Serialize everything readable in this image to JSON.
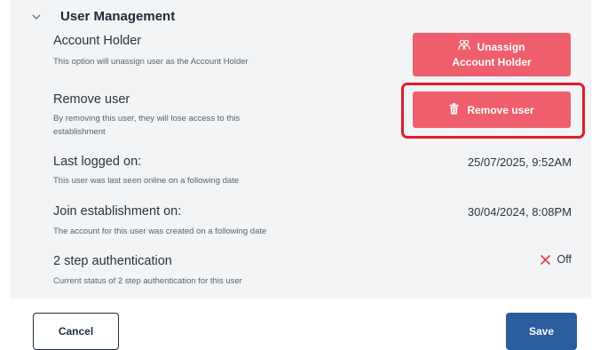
{
  "section": {
    "title": "User Management",
    "chevron_icon": "chevron-down-icon"
  },
  "account_holder": {
    "title": "Account Holder",
    "description": "This option will unassign user as the Account Holder",
    "button_line1": "Unassign",
    "button_line2": "Account Holder",
    "button_icon": "users-icon"
  },
  "remove_user": {
    "title": "Remove user",
    "description_line1": "By removing this user, they will lose access to this",
    "description_line2": "establishment",
    "button_label": "Remove user",
    "button_icon": "trash-icon"
  },
  "last_logged": {
    "title": "Last logged on:",
    "description": "This user was last seen online on a following date",
    "value": "25/07/2025, 9:52AM"
  },
  "join_establishment": {
    "title": "Join establishment on:",
    "description": "The account for this user was created on a following date",
    "value": "30/04/2024, 8:08PM"
  },
  "two_step": {
    "title": "2 step authentication",
    "description": "Current status of 2 step authentication for this user",
    "status": "Off",
    "status_icon": "x-icon"
  },
  "footer": {
    "cancel_label": "Cancel",
    "save_label": "Save"
  },
  "colors": {
    "danger": "#ef5e6c",
    "highlight": "#e01e2a",
    "primary": "#2a5d9e",
    "panel": "#f2f4f5"
  }
}
